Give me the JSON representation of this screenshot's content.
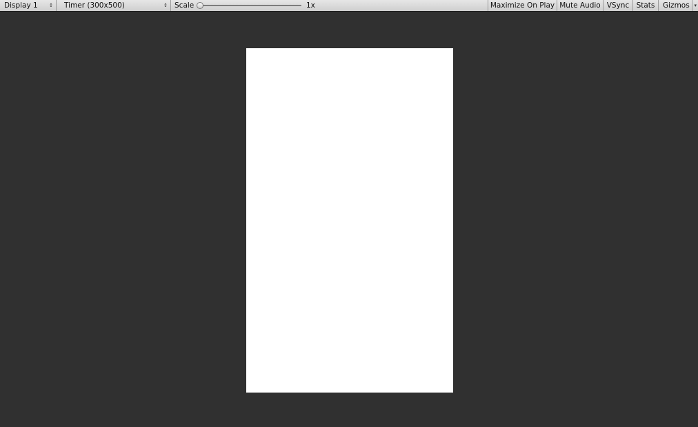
{
  "toolbar": {
    "display": {
      "label": "Display 1",
      "arrow": "↕"
    },
    "resolution": {
      "label": "Timer (300x500)",
      "arrow": "↕"
    },
    "scale": {
      "label": "Scale",
      "value": "1x",
      "fraction": 0
    },
    "maximize_on_play": "Maximize On Play",
    "mute_audio": "Mute Audio",
    "vsync": "VSync",
    "stats": "Stats",
    "gizmos": {
      "label": "Gizmos",
      "arrow": "▾"
    }
  },
  "colors": {
    "background": "#303030",
    "game_view": "#ffffff",
    "toolbar": "#dcdcdc"
  }
}
